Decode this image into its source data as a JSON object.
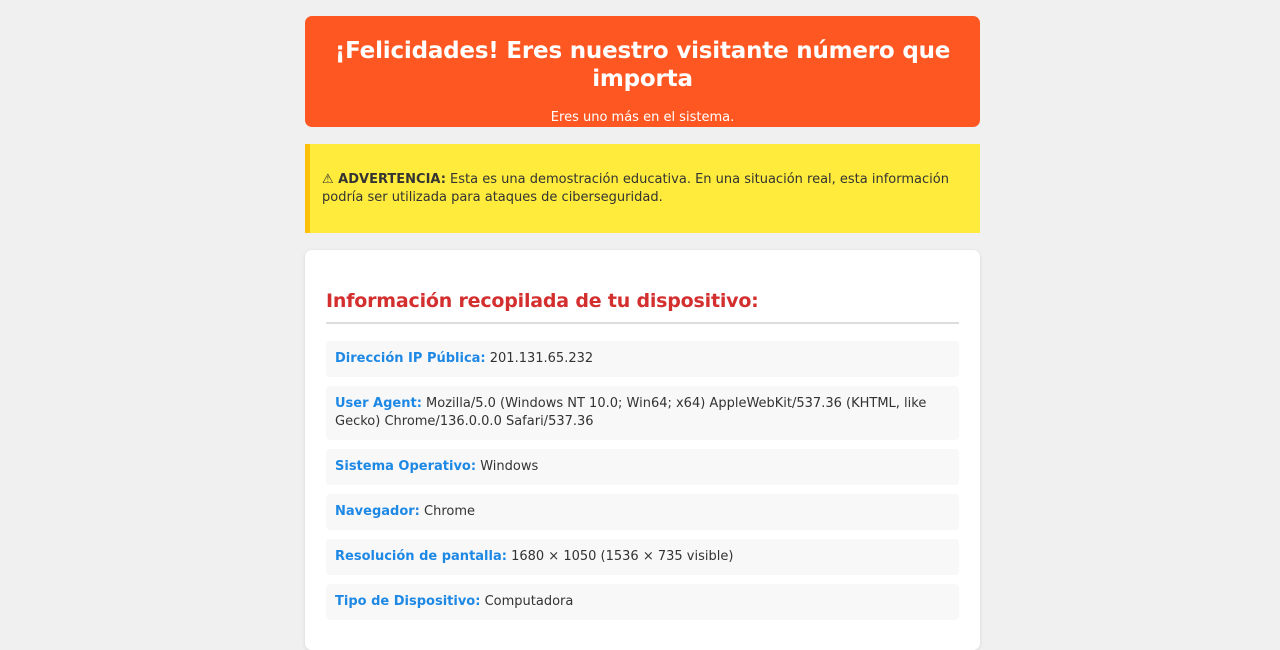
{
  "banner": {
    "title": "¡Felicidades! Eres nuestro visitante número que importa",
    "subtitle": "Eres uno más en el sistema."
  },
  "warning": {
    "icon": "warning-icon",
    "label": "⚠ ADVERTENCIA:",
    "text": "Esta es una demostración educativa. En una situación real, esta información podría ser utilizada para ataques de ciberseguridad."
  },
  "info": {
    "title": "Información recopilada de tu dispositivo:",
    "items": [
      {
        "label": "Dirección IP Pública:",
        "value": "201.131.65.232"
      },
      {
        "label": "User Agent:",
        "value": "Mozilla/5.0 (Windows NT 10.0; Win64; x64) AppleWebKit/537.36 (KHTML, like Gecko) Chrome/136.0.0.0 Safari/537.36"
      },
      {
        "label": "Sistema Operativo:",
        "value": "Windows"
      },
      {
        "label": "Navegador:",
        "value": "Chrome"
      },
      {
        "label": "Resolución de pantalla:",
        "value": "1680 × 1050 (1536 × 735 visible)"
      },
      {
        "label": "Tipo de Dispositivo:",
        "value": "Computadora"
      }
    ]
  },
  "colors": {
    "banner_bg": "#ff5722",
    "warning_bg": "#ffeb3b",
    "warning_border": "#ffc107",
    "title_red": "#d32f2f",
    "label_blue": "#1e88e5"
  }
}
